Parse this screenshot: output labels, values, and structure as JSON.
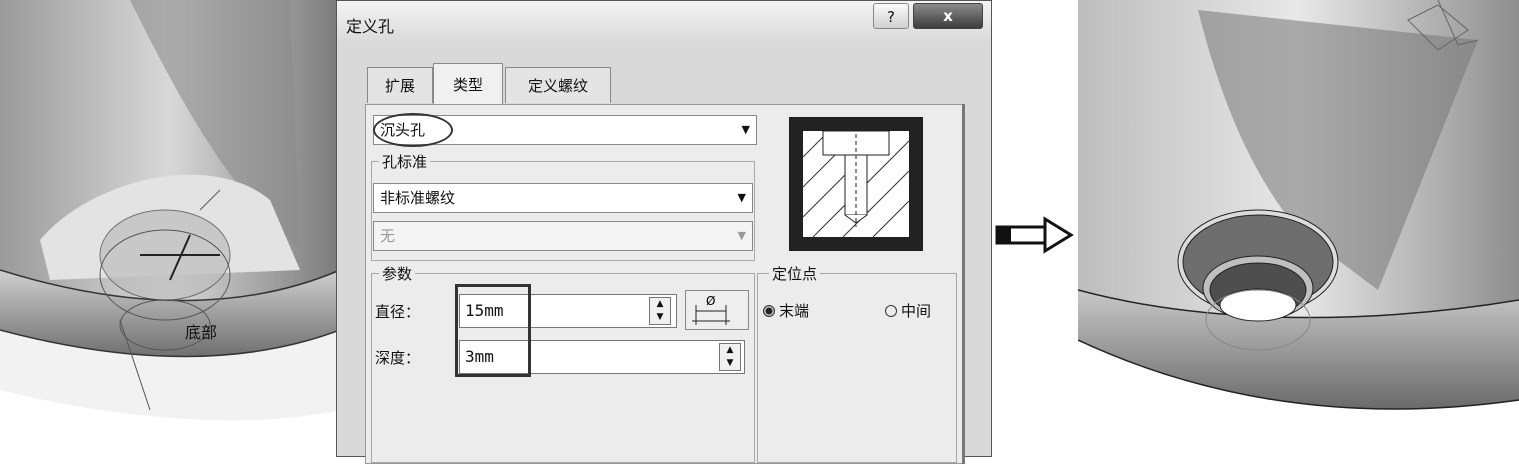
{
  "dialog": {
    "title": "定义孔",
    "help_label": "?",
    "close_label": "x",
    "tabs": [
      {
        "label": "扩展"
      },
      {
        "label": "类型",
        "active": true
      },
      {
        "label": "定义螺纹"
      }
    ],
    "hole_type": {
      "value": "沉头孔"
    },
    "hole_standard": {
      "label": "孔标准",
      "value": "非标准螺纹",
      "sub_value": "无"
    },
    "parameters": {
      "label": "参数",
      "diameter_label": "直径：",
      "diameter_value": "15mm",
      "depth_label": "深度：",
      "depth_value": "3mm"
    },
    "positioning": {
      "label": "定位点",
      "options": [
        {
          "label": "末端",
          "selected": true
        },
        {
          "label": "中间",
          "selected": false
        }
      ]
    }
  },
  "left_viewport": {
    "labels": [
      "底部"
    ]
  },
  "colors": {
    "model_light": "#e8e8e8",
    "model_dark": "#6a6a6a",
    "dialog_bg": "#d9d9d9"
  }
}
